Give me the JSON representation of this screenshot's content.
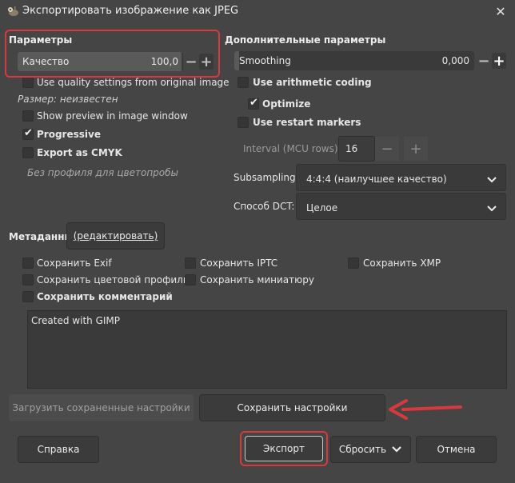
{
  "window": {
    "title": "Экспортировать изображение как JPEG",
    "app_icon": "gimp-wilber-icon",
    "close_icon": "close-icon"
  },
  "params": {
    "title": "Параметры",
    "quality": {
      "label": "Качество",
      "value": "100,0",
      "fraction": 0.99
    },
    "use_original_quality": "Use quality settings from original image",
    "size_text": "Размер: неизвестен",
    "show_preview": "Show preview in image window",
    "progressive": "Progressive",
    "export_cmyk": "Export as CMYK",
    "profile_text": "Без профиля для цветопробы"
  },
  "advanced": {
    "title": "Дополнительные параметры",
    "smoothing": {
      "label": "Smoothing",
      "value": "0,000",
      "fraction": 0.0
    },
    "arithmetic": "Use arithmetic coding",
    "optimize": "Optimize",
    "restart": "Use restart markers",
    "interval_label": "Interval (MCU rows):",
    "interval_value": "16",
    "subsampling_label": "Subsampling",
    "subsampling_value": "4:4:4 (наилучшее качество)",
    "dct_label": "Способ DCT:",
    "dct_value": "Целое"
  },
  "metadata": {
    "title": "Метаданные",
    "edit_label": "(редактировать)",
    "save_exif": "Сохранить Exif",
    "save_iptc": "Сохранить IPTC",
    "save_xmp": "Сохранить XMP",
    "save_color_profile": "Сохранить цветовой профиль",
    "save_thumbnail": "Сохранить миниатюру",
    "save_comment": "Сохранить комментарий",
    "comment_text": "Created with GIMP"
  },
  "buttons": {
    "load_defaults": "Загрузить сохраненные настройки",
    "save_defaults": "Сохранить настройки",
    "help": "Справка",
    "export": "Экспорт",
    "reset": "Сбросить",
    "cancel": "Отмена"
  },
  "colors": {
    "background": "#454545",
    "annotation_red": "#d8393d"
  }
}
